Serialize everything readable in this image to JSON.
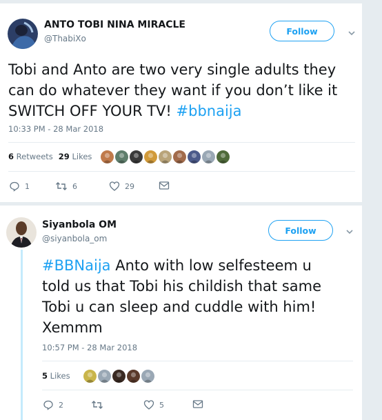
{
  "tweet1": {
    "name": "ANTO TOBI NINA MIRACLE",
    "handle": "@ThabiXo",
    "follow_label": "Follow",
    "text_lines": [
      {
        "text": "Tobi and Anto are two very single adults they",
        "hashtag": ""
      },
      {
        "text": "can do whatever they want if you don’t like it",
        "hashtag": ""
      },
      {
        "text": "SWITCH OFF YOUR TV! ",
        "hashtag": "#bbnaija"
      }
    ],
    "timestamp": "10:33 PM - 28 Mar 2018",
    "retweets_count": "6",
    "retweets_label": "Retweets",
    "likes_count": "29",
    "likes_label": "Likes",
    "reply_count": "1",
    "retweet_count": "6",
    "like_count": "29",
    "liker_colors": [
      "#c07a4a",
      "#5e7d6b",
      "#3a3a3a",
      "#d19a3a",
      "#b9a47a",
      "#a26b4b",
      "#4b5a8a",
      "#9aa8b5",
      "#4f6a3a"
    ]
  },
  "tweet2": {
    "name": "Siyanbola OM",
    "handle": "@siyanbola_om",
    "follow_label": "Follow",
    "text_lines": [
      {
        "text": "",
        "hashtag": "#BBNaija",
        "rest": " Anto with low selfesteem u"
      },
      {
        "text": "told us that Tobi his childish that same",
        "hashtag": ""
      },
      {
        "text": "Tobi u can sleep and cuddle with him!",
        "hashtag": ""
      },
      {
        "text": "Xemmm",
        "hashtag": ""
      }
    ],
    "timestamp": "10:57 PM - 28 Mar 2018",
    "likes_count": "5",
    "likes_label": "Likes",
    "reply_count": "2",
    "retweet_count": "",
    "like_count": "5",
    "liker_colors": [
      "#c9b54a",
      "#9aa8b5",
      "#3a2a22",
      "#5a3a2a",
      "#9aa8b5"
    ]
  },
  "colors": {
    "accent": "#1da1f2",
    "secondary_text": "#657786",
    "background": "#e6ecf0",
    "thread_line": "#c5ebfc"
  }
}
